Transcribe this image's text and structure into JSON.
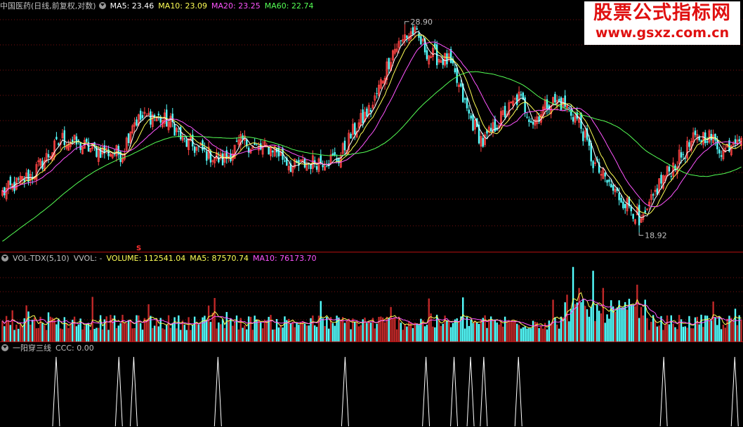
{
  "main_legend": {
    "title": "中国医药(日线,前复权,对数)",
    "items": [
      {
        "text": "MA5: 23.46",
        "color": "#ffffff"
      },
      {
        "text": "MA10: 23.09",
        "color": "#ffff55"
      },
      {
        "text": "MA20: 23.25",
        "color": "#ff55ff"
      },
      {
        "text": "MA60: 22.74",
        "color": "#55ff55"
      }
    ]
  },
  "vol_legend": {
    "title": "VOL-TDX(5,10)",
    "items": [
      {
        "text": "VVOL: -",
        "color": "#c0c0c0"
      },
      {
        "text": "VOLUME: 112541.04",
        "color": "#ffff55"
      },
      {
        "text": "MA5: 87570.74",
        "color": "#ffff55"
      },
      {
        "text": "MA10: 76173.70",
        "color": "#ff55ff"
      }
    ]
  },
  "ind_legend": {
    "title": "一阳穿三线",
    "items": [
      {
        "text": "CCC: 0.00",
        "color": "#c0c0c0"
      }
    ]
  },
  "watermark": {
    "line1": "股票公式指标网",
    "line2": "www.gsxz.com.cn"
  },
  "marker_label": "S",
  "colors": {
    "up": "#ff4444",
    "down": "#54ffff",
    "ma5": "#ffffff",
    "ma10": "#ffff55",
    "ma20": "#ff55ff",
    "ma60": "#55ff55",
    "grid": "#7a1010"
  },
  "chart_data": [
    {
      "type": "candlestick",
      "panel": "price",
      "scale": "log",
      "high_label": "28.90",
      "low_label": "18.92",
      "high": 28.9,
      "low": 18.92,
      "keypoints": [
        [
          0,
          20.5
        ],
        [
          15,
          21.3
        ],
        [
          30,
          22.9
        ],
        [
          45,
          22.4
        ],
        [
          60,
          22.2
        ],
        [
          65,
          23.7
        ],
        [
          75,
          24.0
        ],
        [
          85,
          23.6
        ],
        [
          90,
          22.8
        ],
        [
          100,
          22.3
        ],
        [
          110,
          21.9
        ],
        [
          120,
          22.8
        ],
        [
          128,
          22.4
        ],
        [
          135,
          22.5
        ],
        [
          145,
          21.6
        ],
        [
          158,
          21.9
        ],
        [
          168,
          22.0
        ],
        [
          175,
          23.2
        ],
        [
          185,
          24.5
        ],
        [
          195,
          27.4
        ],
        [
          205,
          28.5
        ],
        [
          213,
          27.2
        ],
        [
          223,
          26.8
        ],
        [
          233,
          24.0
        ],
        [
          240,
          22.7
        ],
        [
          250,
          24.0
        ],
        [
          258,
          24.9
        ],
        [
          265,
          23.7
        ],
        [
          273,
          24.7
        ],
        [
          280,
          24.6
        ],
        [
          288,
          23.7
        ],
        [
          295,
          21.8
        ],
        [
          305,
          20.6
        ],
        [
          315,
          19.8
        ],
        [
          320,
          19.3
        ],
        [
          328,
          20.9
        ],
        [
          338,
          22.0
        ],
        [
          345,
          22.8
        ],
        [
          352,
          23.1
        ],
        [
          360,
          22.3
        ],
        [
          367,
          23.1
        ]
      ]
    },
    {
      "type": "bar",
      "panel": "volume",
      "series": [
        "VOLUME",
        "MA5",
        "MA10"
      ]
    },
    {
      "type": "line",
      "panel": "indicator",
      "series": [
        "CCC"
      ],
      "signal_indices": [
        34,
        72,
        81,
        132,
        209,
        258,
        275,
        285,
        293,
        314,
        402,
        445
      ]
    }
  ]
}
